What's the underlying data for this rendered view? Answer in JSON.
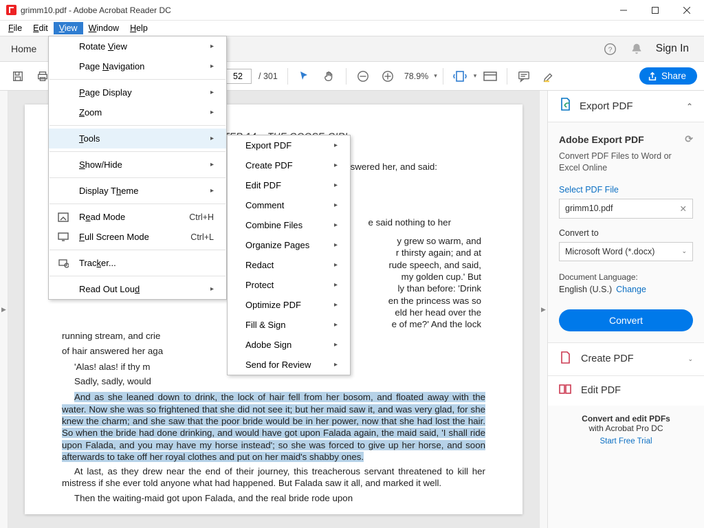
{
  "window": {
    "title": "grimm10.pdf - Adobe Acrobat Reader DC"
  },
  "menubar": {
    "file": "File",
    "edit": "Edit",
    "view": "View",
    "window": "Window",
    "help": "Help"
  },
  "tabs": {
    "home": "Home",
    "sign_in": "Sign In"
  },
  "toolbar": {
    "page_current": "52",
    "page_total": "/ 301",
    "zoom": "78.9%",
    "share": "Share"
  },
  "view_menu": {
    "rotate_view": "Rotate View",
    "page_navigation": "Page Navigation",
    "page_display": "Page Display",
    "zoom": "Zoom",
    "tools": "Tools",
    "show_hide": "Show/Hide",
    "display_theme": "Display Theme",
    "read_mode": "Read Mode",
    "read_mode_sc": "Ctrl+H",
    "full_screen": "Full Screen Mode",
    "full_screen_sc": "Ctrl+L",
    "tracker": "Tracker...",
    "read_out_loud": "Read Out Loud"
  },
  "tools_submenu": {
    "export_pdf": "Export PDF",
    "create_pdf": "Create PDF",
    "edit_pdf": "Edit PDF",
    "comment": "Comment",
    "combine_files": "Combine Files",
    "organize_pages": "Organize Pages",
    "redact": "Redact",
    "protect": "Protect",
    "optimize_pdf": "Optimize PDF",
    "fill_sign": "Fill & Sign",
    "adobe_sign": "Adobe Sign",
    "send_for_review": "Send for Review"
  },
  "document": {
    "chapter_label": "CHAPTER 14.",
    "chapter_title": "THE GOOSE-GIRL",
    "frag1": "nswered her, and said:",
    "frag2": "e said nothing to her",
    "frag3_lines": "y grew so warm, and|r thirsty again; and at|rude speech, and said,|my golden cup.'   But|ly than before:  'Drink|en the princess was so|eld her head over the|e of me?'  And the lock",
    "p_running": "running stream, and crie",
    "p_hair": "of hair answered her aga",
    "p_alas1": "'Alas! alas! if thy m",
    "p_alas2": "Sadly, sadly, would",
    "p_high": "And as she leaned down to drink, the lock of hair fell from her bosom, and floated away with the water.  Now she was so frightened that she did not see it; but her maid saw it, and was very glad, for she knew the charm; and she saw that the poor bride would be in her power, now that she had lost the hair.  So when the bride had done drinking, and would have got upon Falada again, the maid said, 'I shall ride upon Falada, and you may have my horse instead'; so she was forced to give up her horse, and soon afterwards to take off her royal clothes and put on her maid's shabby ones.",
    "p_atlast": "At last, as they drew near the end of their journey, this treacherous servant threatened to kill her mistress if she ever told anyone what had happened. But Falada saw it all, and marked it well.",
    "p_then": "Then the waiting-maid got upon Falada, and the real bride rode upon"
  },
  "side": {
    "export_header": "Export PDF",
    "title": "Adobe Export PDF",
    "subtitle": "Convert PDF Files to Word or Excel Online",
    "select_file": "Select PDF File",
    "filename": "grimm10.pdf",
    "convert_to": "Convert to",
    "format": "Microsoft Word (*.docx)",
    "doc_lang_label": "Document Language:",
    "doc_lang_value": "English (U.S.)",
    "change": "Change",
    "convert": "Convert",
    "create_pdf": "Create PDF",
    "edit_pdf": "Edit PDF",
    "footer1": "Convert and edit PDFs",
    "footer2": "with Acrobat Pro DC",
    "trial": "Start Free Trial"
  }
}
